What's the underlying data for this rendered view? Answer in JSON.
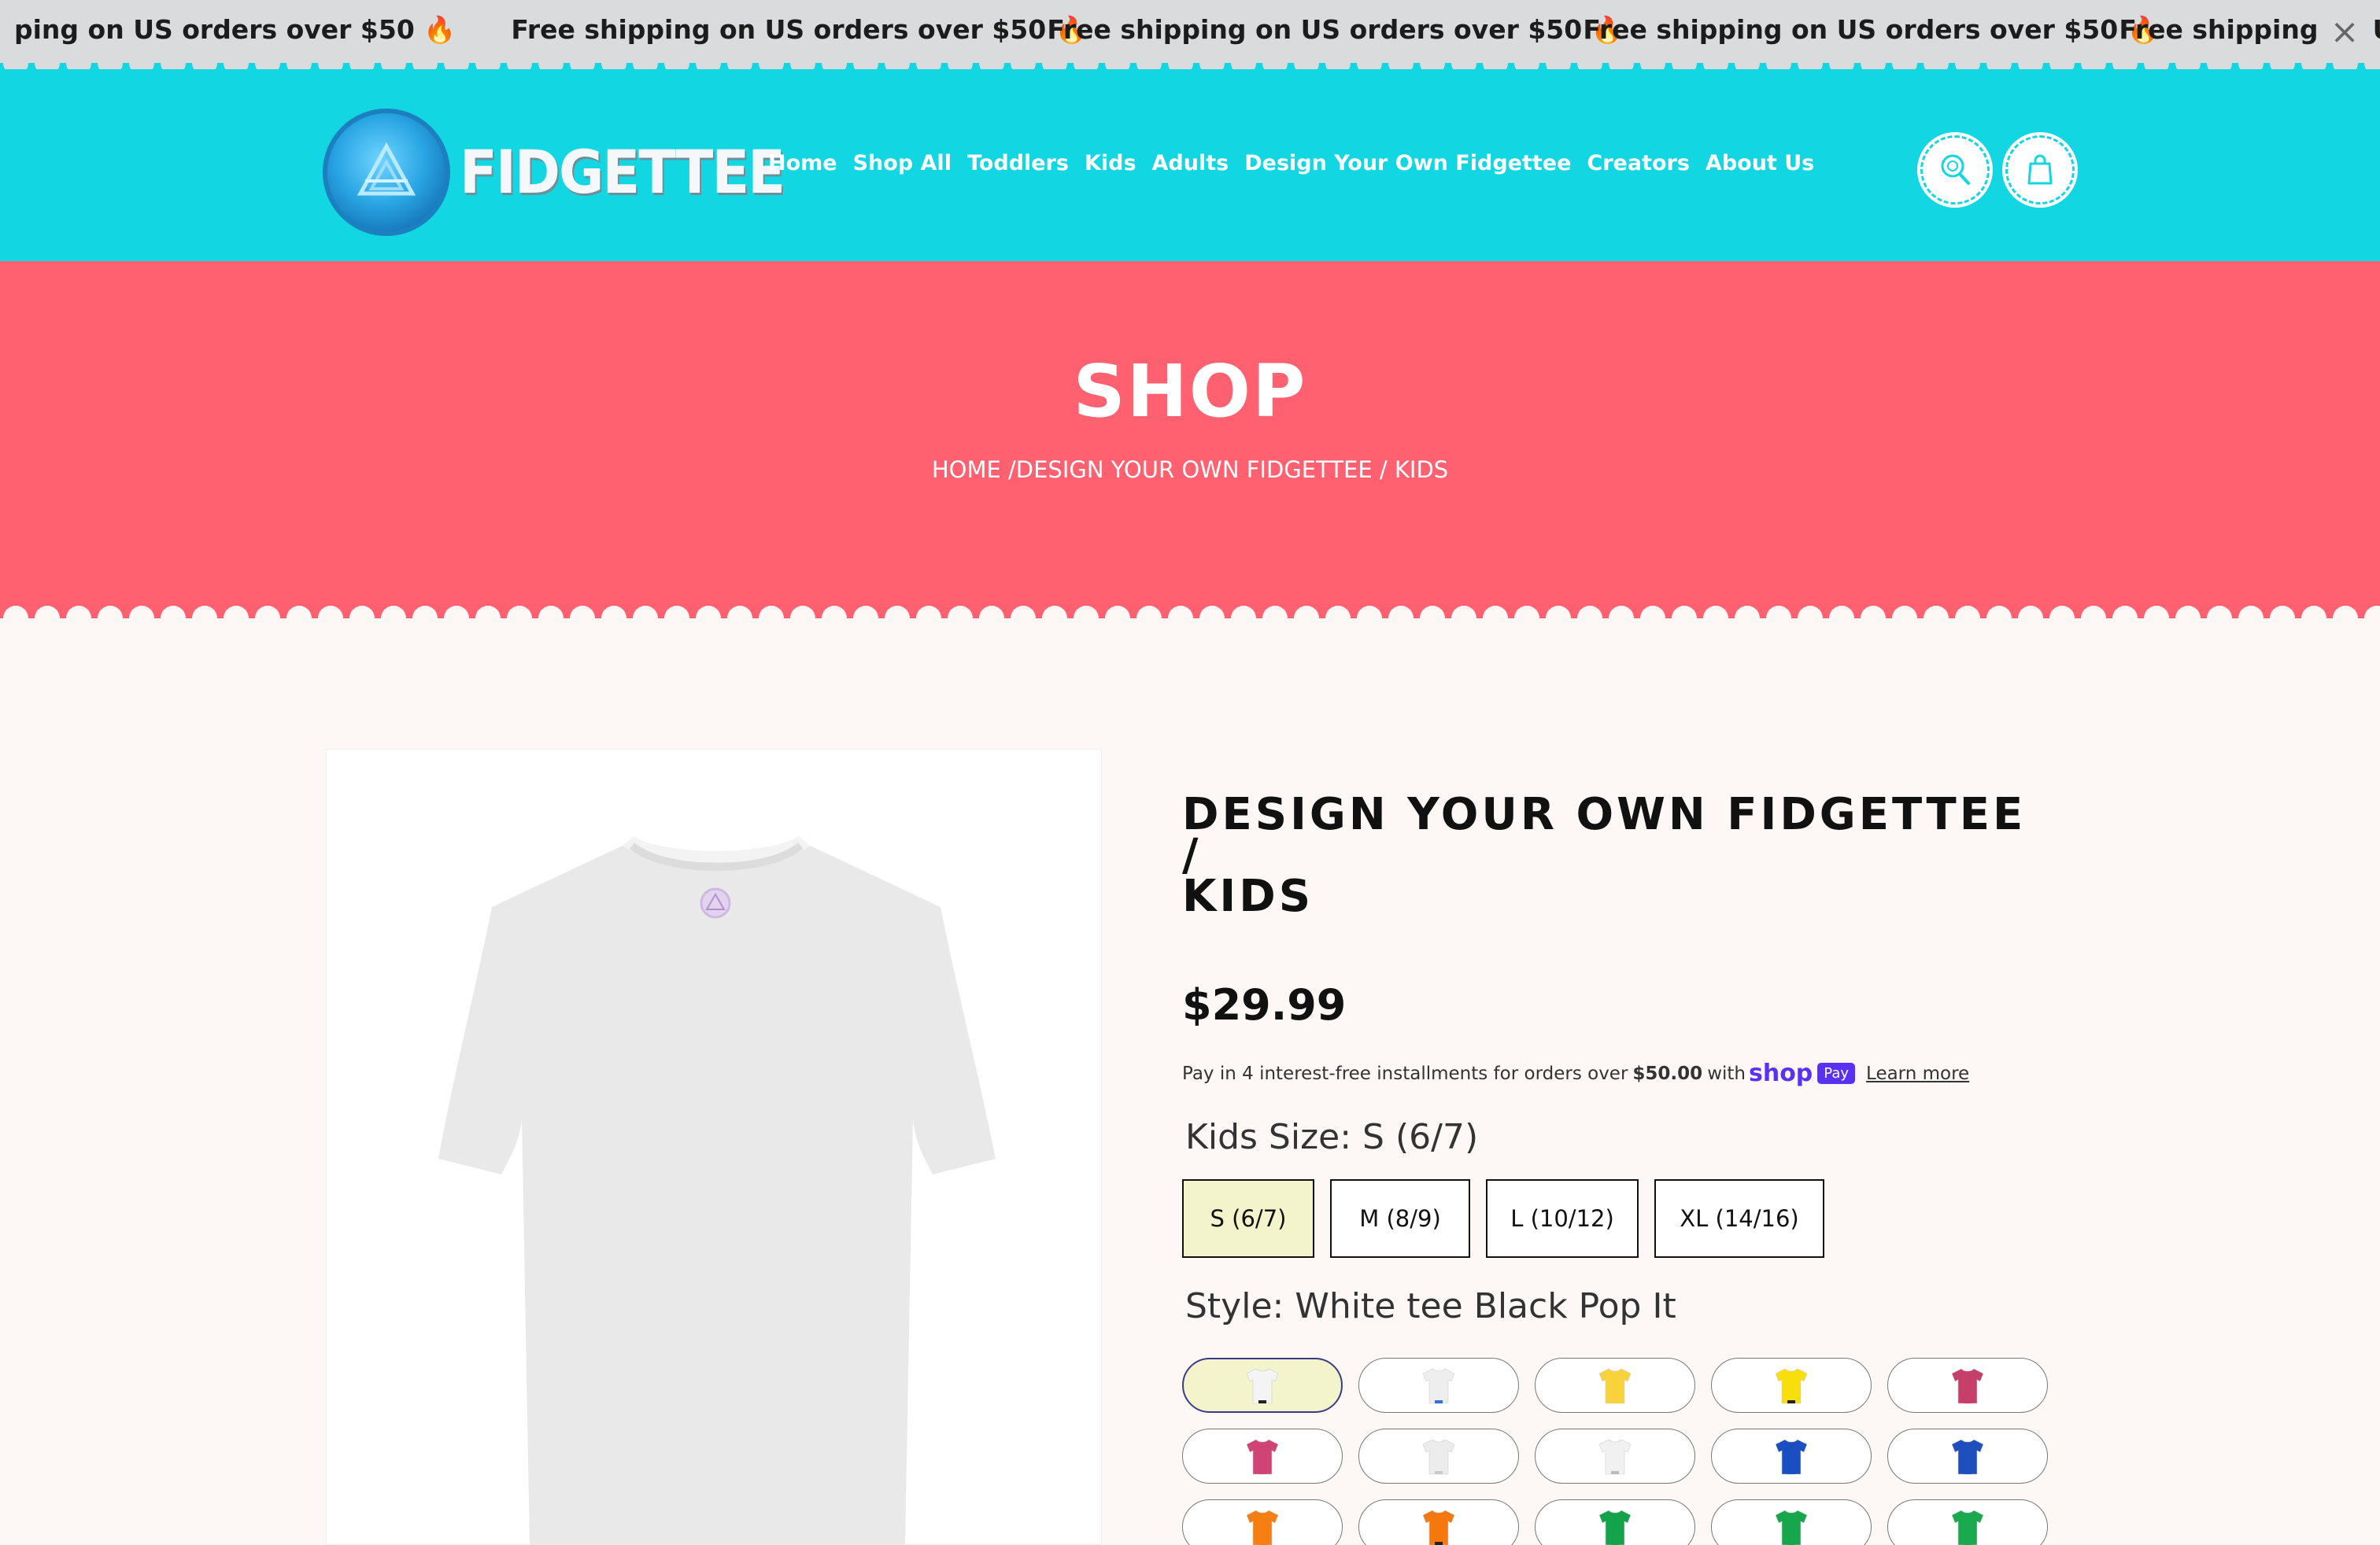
{
  "announcement": {
    "messages": [
      "ping on US orders over $50 🔥",
      "Free shipping on US orders over $50 🔥",
      "Free shipping on US orders over $50 🔥",
      "Free shipping on US orders over $50 🔥",
      "Free shipping on US"
    ],
    "close_label": "×"
  },
  "header": {
    "logo_text": "FIDGETTEE",
    "nav": [
      "Home",
      "Shop All",
      "Toddlers",
      "Kids",
      "Adults",
      "Design Your Own Fidgettee",
      "Creators",
      "About Us"
    ],
    "icons": [
      "search-icon",
      "cart-icon"
    ]
  },
  "hero": {
    "title": "SHOP",
    "breadcrumb": "HOME /DESIGN YOUR OWN FIDGETTEE / KIDS"
  },
  "product": {
    "title_line1": "DESIGN YOUR OWN FIDGETTEE /",
    "title_line2": "KIDS",
    "price": "$29.99",
    "installments_text": "Pay in 4 interest-free installments for orders over",
    "installments_amount": "$50.00",
    "installments_with": "with",
    "shop_word": "shop",
    "pay_badge": "Pay",
    "learn_more": "Learn more",
    "size_label": "Kids Size: S (6/7)",
    "sizes": [
      {
        "label": "S (6/7)",
        "selected": true
      },
      {
        "label": "M (8/9)",
        "selected": false
      },
      {
        "label": "L (10/12)",
        "selected": false
      },
      {
        "label": "XL (14/16)",
        "selected": false
      }
    ],
    "style_label": "Style: White tee Black Pop It",
    "styles": [
      {
        "color": "#f4f4f4",
        "accent": "#222222",
        "selected": true
      },
      {
        "color": "#eeeeee",
        "accent": "#3a6fd8",
        "selected": false
      },
      {
        "color": "#f7d23a",
        "accent": "#f7d23a",
        "selected": false
      },
      {
        "color": "#f8df0c",
        "accent": "#222222",
        "selected": false
      },
      {
        "color": "#c53f6a",
        "accent": "#c53f6a",
        "selected": false
      },
      {
        "color": "#cf4474",
        "accent": "#cf4474",
        "selected": false
      },
      {
        "color": "#ececec",
        "accent": "#cccccc",
        "selected": false
      },
      {
        "color": "#f1f1f1",
        "accent": "#bbbbbb",
        "selected": false
      },
      {
        "color": "#1b4fc1",
        "accent": "#1b4fc1",
        "selected": false
      },
      {
        "color": "#1e4fbd",
        "accent": "#1e4fbd",
        "selected": false
      },
      {
        "color": "#f57f12",
        "accent": "#f57f12",
        "selected": false
      },
      {
        "color": "#f5780e",
        "accent": "#222222",
        "selected": false
      },
      {
        "color": "#14a34a",
        "accent": "#14a34a",
        "selected": false
      },
      {
        "color": "#18a64c",
        "accent": "#18a64c",
        "selected": false
      },
      {
        "color": "#1aa94f",
        "accent": "#1aa94f",
        "selected": false
      }
    ]
  },
  "colors": {
    "announce_bg": "#d9dbdc",
    "header_bg": "#12d6e2",
    "hero_bg": "#ff6170",
    "page_bg": "#fdf8f5",
    "shop_pay": "#5a31f4"
  }
}
